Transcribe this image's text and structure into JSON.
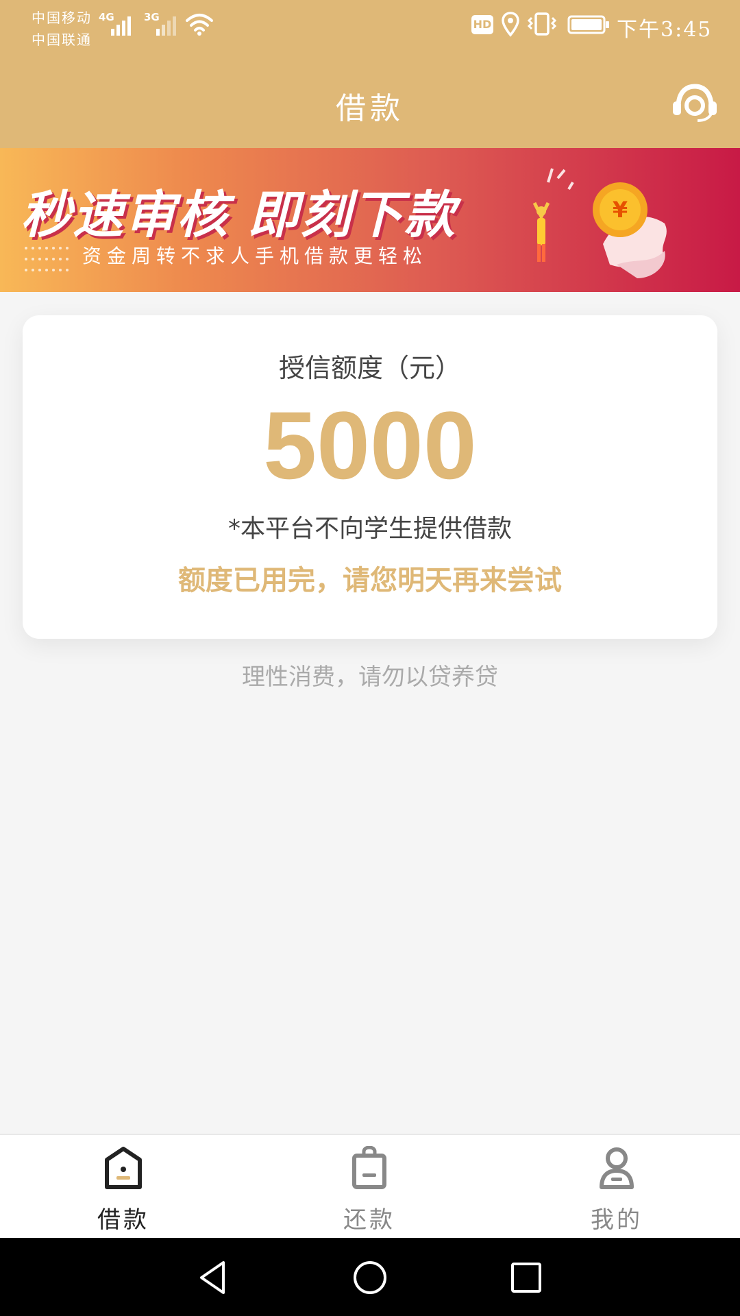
{
  "status_bar": {
    "carrier_1": "中国移动",
    "carrier_2": "中国联通",
    "network_1": "4G",
    "network_2": "3G",
    "hd": "HD",
    "time": "下午3:45"
  },
  "header": {
    "title": "借款",
    "support_icon": "headset-icon"
  },
  "banner": {
    "headline": "秒速审核 即刻下款",
    "subline": "资金周转不求人手机借款更轻松"
  },
  "credit_card": {
    "label": "授信额度（元）",
    "amount": "5000",
    "student_notice": "*本平台不向学生提供借款",
    "status": "额度已用完，请您明天再来尝试"
  },
  "tip": "理性消费，请勿以贷养贷",
  "tabs": [
    {
      "label": "借款",
      "icon": "home-icon",
      "active": true
    },
    {
      "label": "还款",
      "icon": "bag-icon",
      "active": false
    },
    {
      "label": "我的",
      "icon": "user-icon",
      "active": false
    }
  ],
  "colors": {
    "brand": "#dfb877",
    "banner_start": "#f8b857",
    "banner_end": "#c81a46"
  }
}
